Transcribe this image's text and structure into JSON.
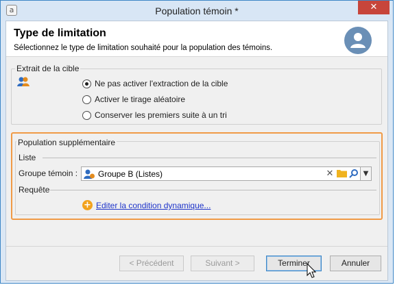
{
  "window": {
    "title": "Population témoin *",
    "close_glyph": "✕",
    "app_icon": "adobe-campaign-icon"
  },
  "header": {
    "title": "Type de limitation",
    "subtitle": "Sélectionnez le type de limitation souhaité pour la population des témoins."
  },
  "extract_group": {
    "legend": "Extrait de la cible",
    "options": [
      {
        "label": "Ne pas activer l'extraction de la cible",
        "checked": true
      },
      {
        "label": "Activer le tirage aléatoire",
        "checked": false
      },
      {
        "label": "Conserver les premiers suite à un tri",
        "checked": false
      }
    ]
  },
  "additional_group": {
    "legend": "Population supplémentaire",
    "list_label": "Liste",
    "control_group_label": "Groupe témoin :",
    "control_group_value": "Groupe B (Listes)",
    "query_label": "Requête",
    "edit_link": "Editer la condition dynamique..."
  },
  "buttons": {
    "previous": "< Précédent",
    "next": "Suivant >",
    "finish": "Terminer",
    "cancel": "Annuler"
  },
  "colors": {
    "highlight": "#f09a45",
    "link": "#1d33c9",
    "close": "#c7453b"
  }
}
